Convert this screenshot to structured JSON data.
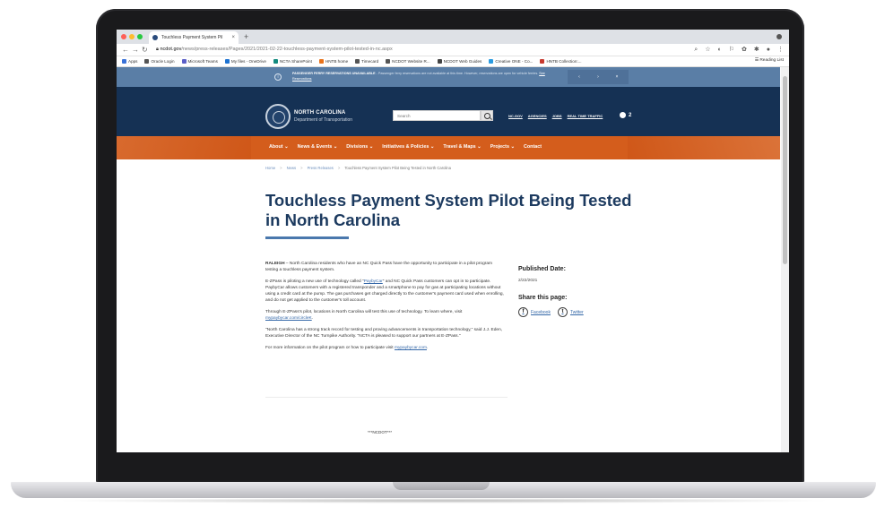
{
  "browser": {
    "tab_title": "Touchless Payment System Pil",
    "tab_close": "×",
    "new_tab": "+",
    "url_host": "ncdot.gov",
    "url_path": "/news/press-releases/Pages/2021/2021-02-22-touchless-payment-system-pilot-tested-in-nc.aspx",
    "bookmarks": [
      "Apps",
      "Oracle Login",
      "Microsoft Teams",
      "My files - OneDrive",
      "NCTA SharePoint",
      "HNTB home",
      "Timecard",
      "NCDOT Website R...",
      "NCDOT Web Guides",
      "Creative ONE - Co...",
      "HNTB Collection:..."
    ],
    "reading_list": "Reading List"
  },
  "alert": {
    "headline": "PASSENGER FERRY RESERVATIONS UNAVAILABLE",
    "text": " - Passenger ferry reservations are not available at this time. However, reservations are open for vehicle ferries.",
    "link": "See Reservations"
  },
  "header": {
    "org_name": "NORTH CAROLINA",
    "org_sub": "Department of Transportation",
    "search_placeholder": "Search",
    "links": [
      "NC.GOV",
      "AGENCIES",
      "JOBS",
      "REAL TIME TRAFFIC"
    ],
    "alert_count": "2"
  },
  "nav": [
    "About ⌄",
    "News & Events ⌄",
    "Divisions ⌄",
    "Initiatives & Policies ⌄",
    "Travel & Maps ⌄",
    "Projects ⌄",
    "Contact"
  ],
  "breadcrumb": {
    "home": "Home",
    "news": "News",
    "press": "Press Releases",
    "current": "Touchless Payment System Pilot Being Tested in North Carolina",
    "sep": ">"
  },
  "article": {
    "title": "Touchless Payment System Pilot Being Tested in North Carolina",
    "p1_lead": "RALEIGH",
    "p1": " – North Carolina residents who have an NC Quick Pass have the opportunity to participate in a pilot program testing a touchless payment system.",
    "p2_a": "E-ZPass is piloting a new use of technology called \"",
    "p2_link": "PaybyCar",
    "p2_b": "\" and NC Quick Pass customers can opt in to participate. PaybyCar allows customers with a registered transponder and a smartphone to pay for gas at participating locations without using a credit card at the pump. The gas purchases get charged directly to the customer's payment card used when enrolling, and do not get applied to the customer's toll account.",
    "p3_a": "Through E-ZPass's pilot, locations in North Carolina will test this use of technology. To learn where, visit ",
    "p3_link": "mypaybycar.com/circleK",
    "p3_b": ".",
    "p4": "\"North Carolina has a strong track record for testing and proving advancements in transportation technology,\" said J.J. Eden, Executive Director of the NC Turnpike Authority. \"NCTA is pleased to support our partners at E-ZPass.\"",
    "p5_a": "For more information on the pilot program or how to participate visit ",
    "p5_link": "mypaybycar.com",
    "p5_b": ".",
    "footer_mark": "***NCDOT***"
  },
  "sidebar": {
    "published_label": "Published Date:",
    "published_date": "2/22/2021",
    "share_label": "Share this page:",
    "facebook": "Facebook",
    "twitter": "Twitter"
  }
}
